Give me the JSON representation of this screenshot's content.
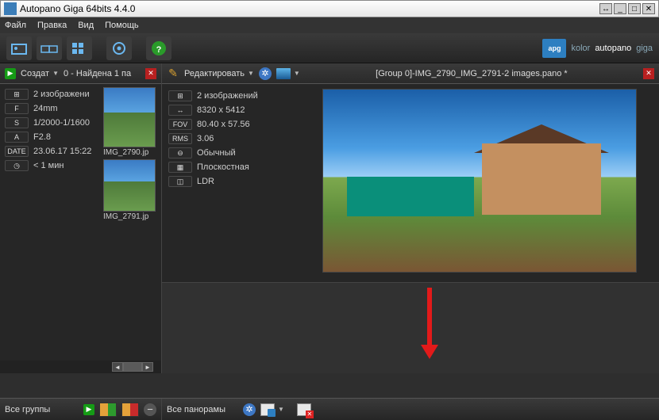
{
  "window": {
    "title": "Autopano Giga 64bits 4.4.0"
  },
  "menu": {
    "file": "Файл",
    "edit": "Правка",
    "view": "Вид",
    "help": "Помощь"
  },
  "brand": {
    "pre": "kolor",
    "main": "autopano",
    "post": "giga",
    "logo": "apg"
  },
  "left_panel": {
    "create_label": "Создат",
    "status": "0 - Найдена 1 па",
    "meta": {
      "images": {
        "label": "2 изображени"
      },
      "focal": {
        "badge": "F",
        "value": "24mm"
      },
      "shutter": {
        "badge": "S",
        "value": "1/2000-1/1600"
      },
      "aperture": {
        "badge": "A",
        "value": "F2.8"
      },
      "date": {
        "badge": "DATE",
        "value": "23.06.17 15:22"
      },
      "time": {
        "value": "< 1 мин"
      }
    },
    "thumbs": [
      {
        "caption": "IMG_2790.jp"
      },
      {
        "caption": "IMG_2791.jp"
      }
    ]
  },
  "right_panel": {
    "edit_label": "Редактировать",
    "pano_title": "[Group 0]-IMG_2790_IMG_2791-2 images.pano *",
    "meta": {
      "images": {
        "value": "2 изображений"
      },
      "size": {
        "value": "8320 x 5412"
      },
      "fov": {
        "badge": "FOV",
        "value": "80.40 x 57.56"
      },
      "rms": {
        "badge": "RMS",
        "value": "3.06"
      },
      "mode": {
        "value": "Обычный"
      },
      "proj": {
        "value": "Плоскостная"
      },
      "ldr": {
        "value": "LDR"
      }
    }
  },
  "bottom": {
    "all_groups": "Все группы",
    "all_panos": "Все панорамы"
  }
}
